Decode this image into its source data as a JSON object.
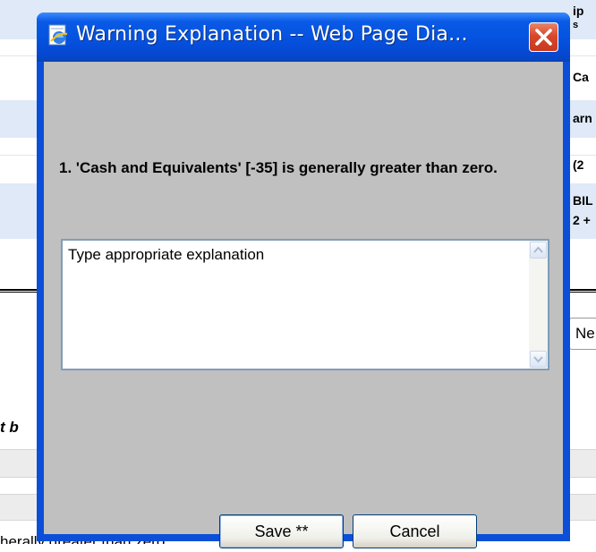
{
  "background": {
    "right_fragments": [
      "ip",
      "s",
      "Ca",
      "arn",
      "(2",
      "BIL",
      "2 +"
    ],
    "new_button_label": "Ne",
    "left_italic_fragment": "t b",
    "bottom_text": "herally greater than zero."
  },
  "dialog": {
    "title": "Warning Explanation -- Web Page Dia...",
    "message": "1. 'Cash and Equivalents' [-35] is generally greater than zero.",
    "explanation_text": "Type appropriate explanation",
    "save_label": "Save **",
    "cancel_label": "Cancel"
  },
  "icons": {
    "title": "ie-page-icon",
    "close": "close-icon",
    "scroll_up": "scroll-up-arrow-icon",
    "scroll_down": "scroll-down-arrow-icon"
  },
  "colors": {
    "titlebar": "#0553e0",
    "client": "#c0c0c0",
    "close": "#d9472a",
    "band": "#dfe9f7"
  }
}
